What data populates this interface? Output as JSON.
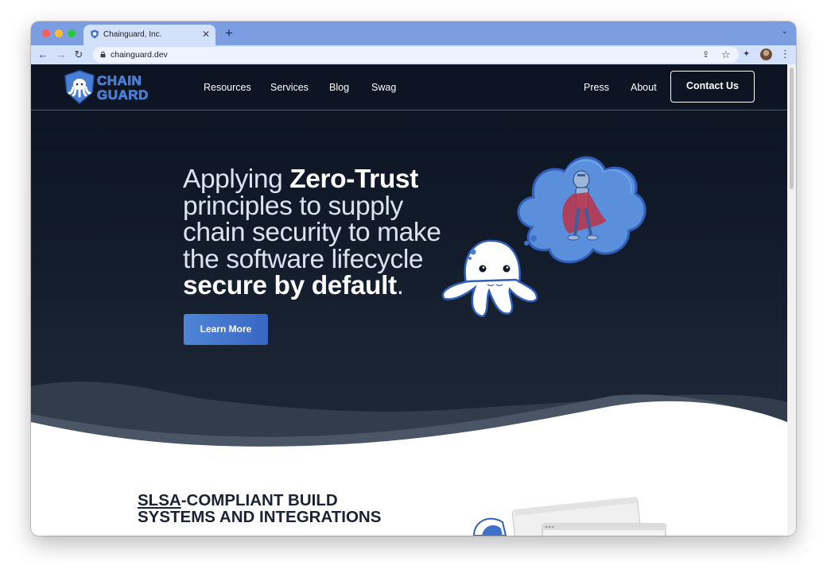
{
  "browser": {
    "tab_title": "Chainguard, Inc.",
    "tab_close": "✕",
    "new_tab": "+",
    "tab_menu": "⌄",
    "url": "chainguard.dev",
    "nav_back": "←",
    "nav_forward": "→",
    "nav_reload": "↻",
    "icons": [
      "share-icon",
      "bookmark-star-icon",
      "extensions-icon",
      "profile-avatar",
      "kebab-menu-icon"
    ],
    "share_glyph": "⇪",
    "star_glyph": "☆",
    "extensions_glyph": "✦",
    "menu_glyph": "⋮"
  },
  "site": {
    "logo_text": [
      "CHAIN",
      "GUARD"
    ],
    "nav_left": [
      "Resources",
      "Services",
      "Blog",
      "Swag"
    ],
    "nav_right": [
      "Press",
      "About"
    ],
    "contact_label": "Contact Us",
    "hero": {
      "line1_regular": "Applying ",
      "line1_bold": "Zero-Trust",
      "line2": "principles to supply chain security to make the software lifecycle",
      "bold_end": "secure by default",
      "period": "."
    },
    "learn_more_label": "Learn More",
    "section_title_link": "SLSA",
    "section_title_rest_1": "-COMPLIANT BUILD",
    "section_title_rest_2": "SYSTEMS AND INTEGRATIONS"
  },
  "colors": {
    "accent": "#3e70cc",
    "hero_bg": "#0f1724",
    "tabstrip": "#7d9de1"
  }
}
